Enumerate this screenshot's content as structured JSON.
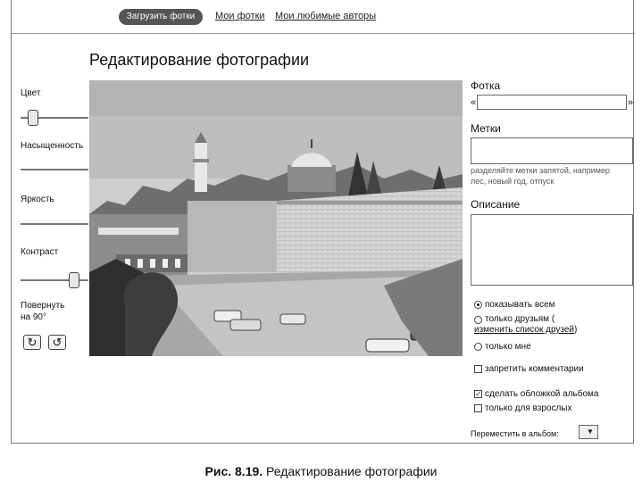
{
  "nav": {
    "upload_label": "Загрузить фотки",
    "my_photos_label": "Мои фотки",
    "favorite_authors_label": "Мои любимые авторы"
  },
  "page": {
    "title": "Редактирование фотографии"
  },
  "adjust": {
    "color_label": "Цвет",
    "saturation_label": "Насыщенность",
    "brightness_label": "Яркость",
    "contrast_label": "Контраст",
    "rotate_label_line1": "Повернуть",
    "rotate_label_line2": "на 90°",
    "color_level": 0.12,
    "contrast_level": 0.85,
    "rotate_cw_icon": "rotate-clockwise-icon",
    "rotate_ccw_icon": "rotate-counterclockwise-icon"
  },
  "form": {
    "photo_label": "Фотка",
    "photo_value": "",
    "quote_open": "«",
    "quote_close": "»",
    "tags_label": "Метки",
    "tags_value": "",
    "tags_hint": "разделяйте метки запятой, например лес, новый год, отпуск",
    "description_label": "Описание",
    "description_value": "",
    "visibility": {
      "all_label": "показывать всем",
      "friends_label": "только друзьям (",
      "friends_link": "изменить список друзей",
      "friends_close": ")",
      "me_label": "только мне",
      "selected": "all"
    },
    "forbid_comments_label": "запретить комментарии",
    "forbid_comments_checked": false,
    "album_cover_label": "сделать обложкой альбома",
    "album_cover_checked": true,
    "adults_only_label": "только для взрослых",
    "adults_only_checked": false,
    "move_to_album_label": "Переместить в альбом:",
    "move_to_album_value": ""
  },
  "caption": {
    "figure": "Рис. 8.19.",
    "text": " Редактирование фотографии"
  }
}
